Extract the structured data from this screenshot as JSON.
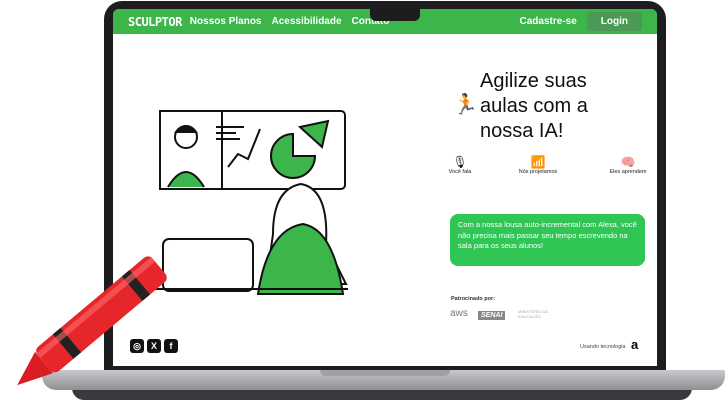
{
  "nav": {
    "logo": "SCULPTOR",
    "links": [
      "Nossos Planos",
      "Acessibilidade",
      "Contato"
    ],
    "signup": "Cadastre-se",
    "login": "Login"
  },
  "hero": {
    "headline": "Agilize suas aulas com a nossa IA!",
    "features": [
      {
        "icon": "microphone-icon",
        "label": "Você fala"
      },
      {
        "icon": "wifi-icon",
        "label": "Nós projetamos"
      },
      {
        "icon": "brain-icon",
        "label": "Eles aprendem"
      }
    ],
    "description": "Com a nossa lousa auto-incremental com Alexa, você não precisa mais passar seu tempo escrevendo na sala para os seus alunos!"
  },
  "sponsors": {
    "label": "Patrocinado por:",
    "items": [
      "aws",
      "SENAI",
      "MINISTÉRIO DA EDUCAÇÃO"
    ]
  },
  "footer": {
    "tech_label": "Usando tecnologia",
    "tech_logo": "a"
  },
  "colors": {
    "primary": "#3cb54a",
    "bubble": "#2fc656"
  }
}
